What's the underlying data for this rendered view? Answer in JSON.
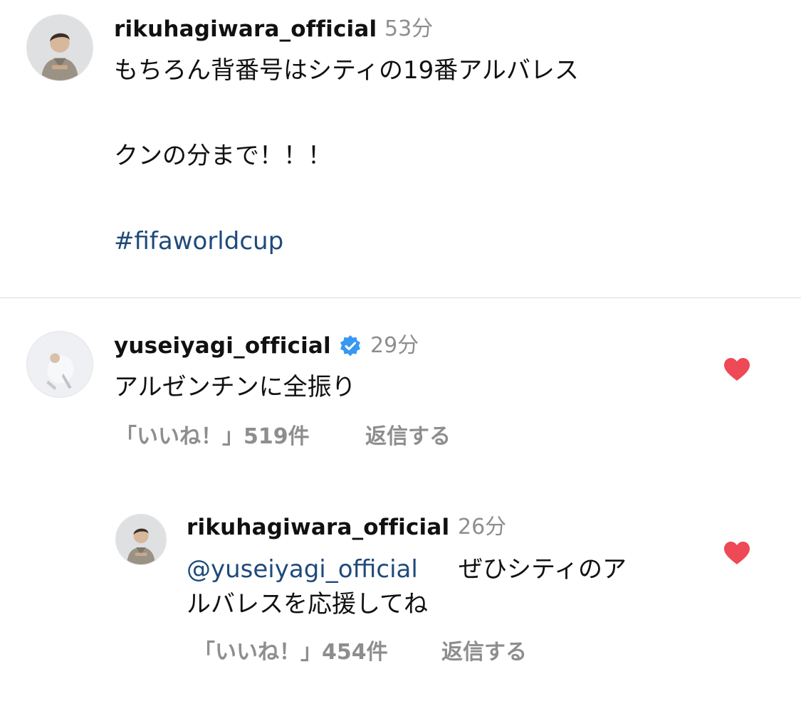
{
  "caption": {
    "username": "rikuhagiwara_official",
    "time": "53分",
    "lines": [
      "もちろん背番号はシティの19番アルバレス",
      "クンの分まで！！！"
    ],
    "hashtag": "#fifaworldcup"
  },
  "comment": {
    "username": "yuseiyagi_official",
    "verified": true,
    "time": "29分",
    "text": "アルゼンチンに全振り",
    "likes": "「いいね！」519件",
    "reply_label": "返信する",
    "liked": true,
    "heart_color": "#ed4956"
  },
  "reply": {
    "username": "rikuhagiwara_official",
    "time": "26分",
    "mention": "@yuseiyagi_official",
    "text_line1": "ぜひシティのア",
    "text_line2": "ルバレスを応援してね",
    "likes": "「いいね！」454件",
    "reply_label": "返信する",
    "liked": true,
    "heart_color": "#ed4956"
  },
  "colors": {
    "verified_badge": "#3897f0",
    "link": "#1f4a7a",
    "secondary_text": "#8e8e8e"
  },
  "icons": {
    "verified": "verified-badge-icon",
    "like": "heart-filled-icon"
  }
}
